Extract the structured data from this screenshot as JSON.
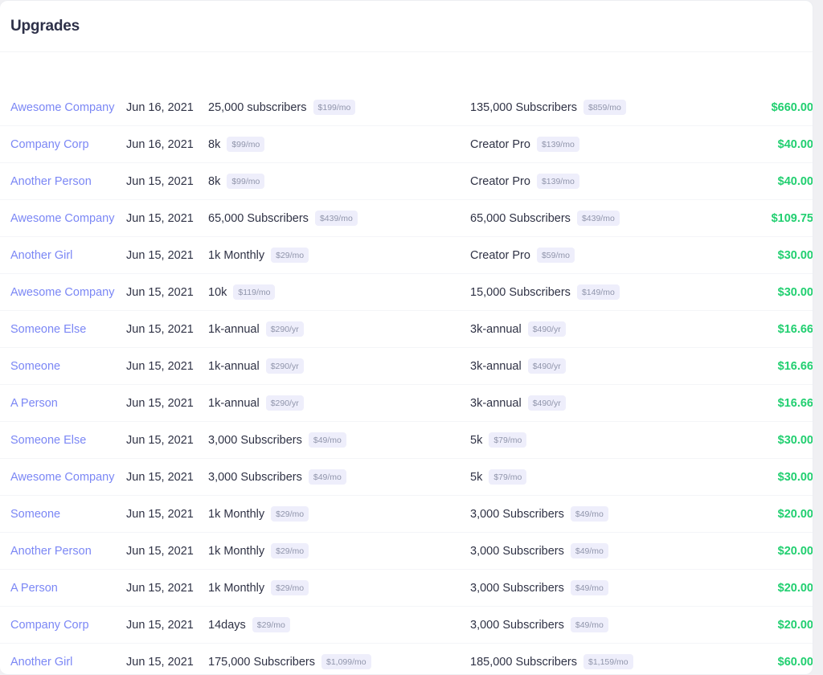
{
  "header": {
    "title": "Upgrades"
  },
  "table": {
    "columns": [
      {
        "key": "customer",
        "label": ""
      },
      {
        "key": "date",
        "label": ""
      },
      {
        "key": "from_plan",
        "label": ""
      },
      {
        "key": "to_plan",
        "label": ""
      },
      {
        "key": "amount",
        "label": ""
      }
    ],
    "rows": [
      {
        "customer": "Awesome Company",
        "date": "Jun 16, 2021",
        "from_plan": "25,000 subscribers",
        "from_price": "$199/mo",
        "to_plan": "135,000 Subscribers",
        "to_price": "$859/mo",
        "amount": "$660.00"
      },
      {
        "customer": "Company Corp",
        "date": "Jun 16, 2021",
        "from_plan": "8k",
        "from_price": "$99/mo",
        "to_plan": "Creator Pro",
        "to_price": "$139/mo",
        "amount": "$40.00"
      },
      {
        "customer": "Another Person",
        "date": "Jun 15, 2021",
        "from_plan": "8k",
        "from_price": "$99/mo",
        "to_plan": "Creator Pro",
        "to_price": "$139/mo",
        "amount": "$40.00"
      },
      {
        "customer": "Awesome Company",
        "date": "Jun 15, 2021",
        "from_plan": "65,000 Subscribers",
        "from_price": "$439/mo",
        "to_plan": "65,000 Subscribers",
        "to_price": "$439/mo",
        "amount": "$109.75"
      },
      {
        "customer": "Another Girl",
        "date": "Jun 15, 2021",
        "from_plan": "1k Monthly",
        "from_price": "$29/mo",
        "to_plan": "Creator Pro",
        "to_price": "$59/mo",
        "amount": "$30.00"
      },
      {
        "customer": "Awesome Company",
        "date": "Jun 15, 2021",
        "from_plan": "10k",
        "from_price": "$119/mo",
        "to_plan": "15,000 Subscribers",
        "to_price": "$149/mo",
        "amount": "$30.00"
      },
      {
        "customer": "Someone Else",
        "date": "Jun 15, 2021",
        "from_plan": "1k-annual",
        "from_price": "$290/yr",
        "to_plan": "3k-annual",
        "to_price": "$490/yr",
        "amount": "$16.66"
      },
      {
        "customer": "Someone",
        "date": "Jun 15, 2021",
        "from_plan": "1k-annual",
        "from_price": "$290/yr",
        "to_plan": "3k-annual",
        "to_price": "$490/yr",
        "amount": "$16.66"
      },
      {
        "customer": "A Person",
        "date": "Jun 15, 2021",
        "from_plan": "1k-annual",
        "from_price": "$290/yr",
        "to_plan": "3k-annual",
        "to_price": "$490/yr",
        "amount": "$16.66"
      },
      {
        "customer": "Someone Else",
        "date": "Jun 15, 2021",
        "from_plan": "3,000 Subscribers",
        "from_price": "$49/mo",
        "to_plan": "5k",
        "to_price": "$79/mo",
        "amount": "$30.00"
      },
      {
        "customer": "Awesome Company",
        "date": "Jun 15, 2021",
        "from_plan": "3,000 Subscribers",
        "from_price": "$49/mo",
        "to_plan": "5k",
        "to_price": "$79/mo",
        "amount": "$30.00"
      },
      {
        "customer": "Someone",
        "date": "Jun 15, 2021",
        "from_plan": "1k Monthly",
        "from_price": "$29/mo",
        "to_plan": "3,000 Subscribers",
        "to_price": "$49/mo",
        "amount": "$20.00"
      },
      {
        "customer": "Another Person",
        "date": "Jun 15, 2021",
        "from_plan": "1k Monthly",
        "from_price": "$29/mo",
        "to_plan": "3,000 Subscribers",
        "to_price": "$49/mo",
        "amount": "$20.00"
      },
      {
        "customer": "A Person",
        "date": "Jun 15, 2021",
        "from_plan": "1k Monthly",
        "from_price": "$29/mo",
        "to_plan": "3,000 Subscribers",
        "to_price": "$49/mo",
        "amount": "$20.00"
      },
      {
        "customer": "Company Corp",
        "date": "Jun 15, 2021",
        "from_plan": "14days",
        "from_price": "$29/mo",
        "to_plan": "3,000 Subscribers",
        "to_price": "$49/mo",
        "amount": "$20.00"
      },
      {
        "customer": "Another Girl",
        "date": "Jun 15, 2021",
        "from_plan": "175,000 Subscribers",
        "from_price": "$1,099/mo",
        "to_plan": "185,000 Subscribers",
        "to_price": "$1,159/mo",
        "amount": "$60.00"
      }
    ]
  },
  "colors": {
    "link": "#7b87f5",
    "amount_positive": "#21cf70",
    "badge_bg": "#eeeefb",
    "badge_text": "#9095ab",
    "title": "#2d3048",
    "row_divider": "#f4f5f8"
  }
}
